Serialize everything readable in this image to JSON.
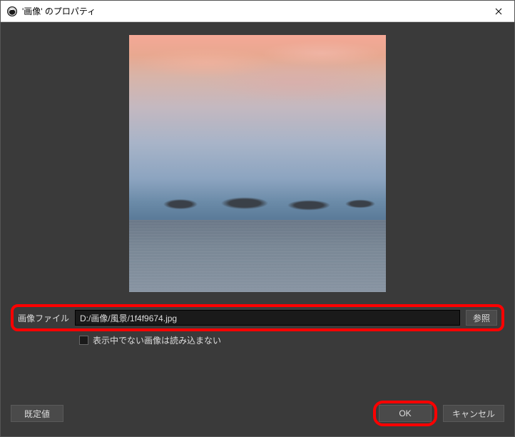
{
  "window": {
    "title": "'画像' のプロパティ"
  },
  "fields": {
    "image_file_label": "画像ファイル",
    "image_file_path": "D:/画像/風景/1f4f9674.jpg",
    "browse_label": "参照",
    "checkbox_label": "表示中でない画像は読み込まない"
  },
  "footer": {
    "defaults_label": "既定値",
    "ok_label": "OK",
    "cancel_label": "キャンセル"
  }
}
